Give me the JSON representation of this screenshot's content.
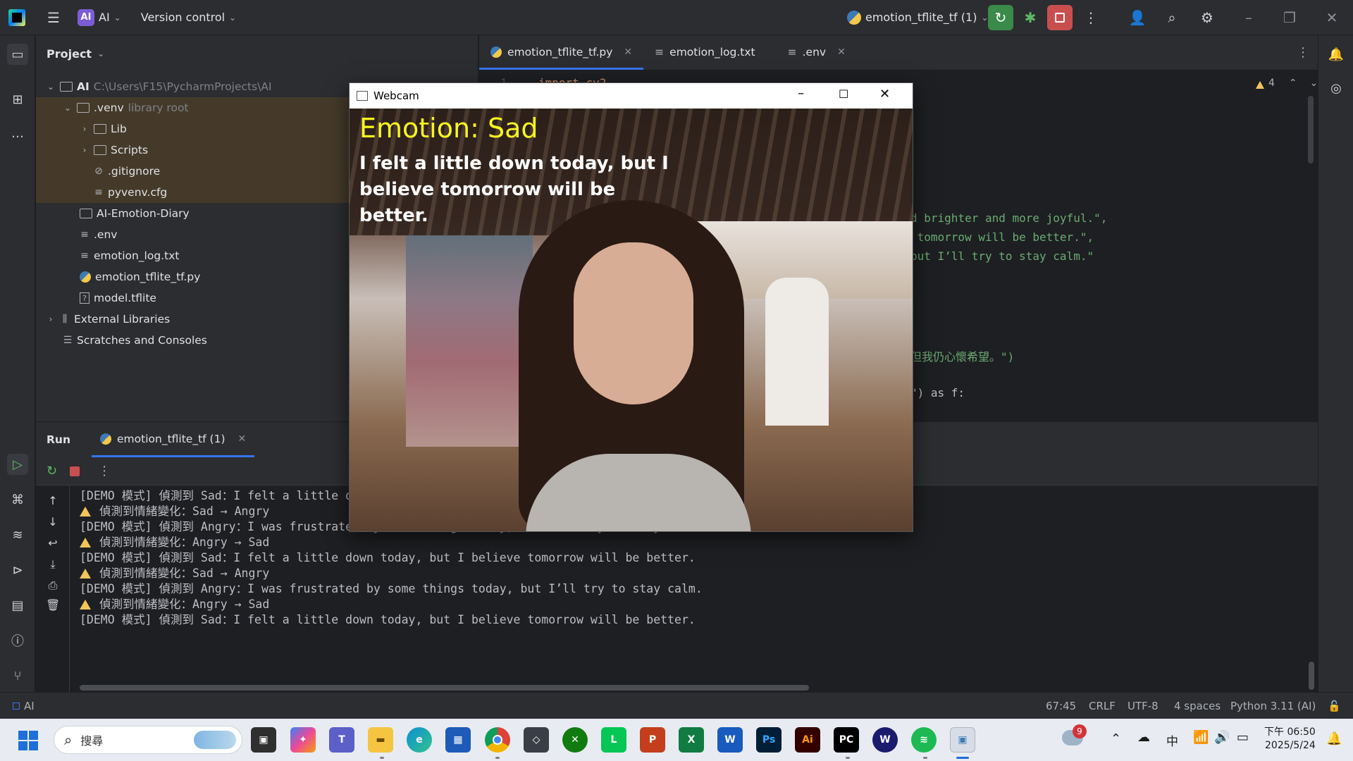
{
  "titlebar": {
    "project_badge": "AI",
    "project_name": "AI",
    "vcs": "Version control",
    "run_config": "emotion_tflite_tf (1)"
  },
  "project": {
    "header": "Project",
    "tree": [
      {
        "label": "AI",
        "extra": "C:\\Users\\F15\\PycharmProjects\\AI",
        "icon": "folder-icon"
      },
      {
        "label": ".venv",
        "extra": "library root",
        "icon": "folder-icon"
      },
      {
        "label": "Lib",
        "icon": "folder-icon"
      },
      {
        "label": "Scripts",
        "icon": "folder-icon"
      },
      {
        "label": ".gitignore",
        "icon": "ignore-file-icon"
      },
      {
        "label": "pyvenv.cfg",
        "icon": "text-file-icon"
      },
      {
        "label": "AI-Emotion-Diary",
        "icon": "folder-icon"
      },
      {
        "label": ".env",
        "icon": "text-file-icon"
      },
      {
        "label": "emotion_log.txt",
        "icon": "text-file-icon"
      },
      {
        "label": "emotion_tflite_tf.py",
        "icon": "python-file-icon"
      },
      {
        "label": "model.tflite",
        "icon": "unknown-file-icon"
      },
      {
        "label": "External Libraries",
        "icon": "library-icon"
      },
      {
        "label": "Scratches and Consoles",
        "icon": "scratches-icon"
      }
    ]
  },
  "editor": {
    "tabs": [
      {
        "label": "emotion_tflite_tf.py",
        "active": true
      },
      {
        "label": "emotion_log.txt",
        "active": false
      },
      {
        "label": ".env",
        "active": false
      }
    ],
    "warnings_count": "4",
    "visible_code": [
      "import cv2",
      "d brighter and more joyful.\",",
      " tomorrow will be better.\",",
      "but I’ll try to stay calm.\"",
      "但我仍心懷希望。\")",
      "\") as f:"
    ]
  },
  "run": {
    "tab_run": "Run",
    "tab_config": "emotion_tflite_tf (1)",
    "lines": [
      {
        "warn": false,
        "text": "[DEMO 模式] 偵測到 Sad：I felt a little d"
      },
      {
        "warn": true,
        "text": "偵測到情緒變化：Sad → Angry"
      },
      {
        "warn": false,
        "text": "[DEMO 模式] 偵測到 Angry：I was frustrated by some things today, but I’ll try to stay calm."
      },
      {
        "warn": true,
        "text": "偵測到情緒變化：Angry → Sad"
      },
      {
        "warn": false,
        "text": "[DEMO 模式] 偵測到 Sad：I felt a little down today, but I believe tomorrow will be better."
      },
      {
        "warn": true,
        "text": "偵測到情緒變化：Sad → Angry"
      },
      {
        "warn": false,
        "text": "[DEMO 模式] 偵測到 Angry：I was frustrated by some things today, but I’ll try to stay calm."
      },
      {
        "warn": true,
        "text": "偵測到情緒變化：Angry → Sad"
      },
      {
        "warn": false,
        "text": "[DEMO 模式] 偵測到 Sad：I felt a little down today, but I believe tomorrow will be better."
      }
    ]
  },
  "webcam": {
    "title": "Webcam",
    "emotion_label": "Emotion: Sad",
    "message": "I felt a little down today, but I believe tomorrow will be better."
  },
  "status": {
    "project": "AI",
    "position": "67:45",
    "line_sep": "CRLF",
    "encoding": "UTF-8",
    "indent": "4 spaces",
    "interpreter": "Python 3.11 (AI)"
  },
  "taskbar": {
    "search_placeholder": "搜尋",
    "weather_badge": "9",
    "ime": "中",
    "time_period": "下午 06:50",
    "date": "2025/5/24"
  }
}
